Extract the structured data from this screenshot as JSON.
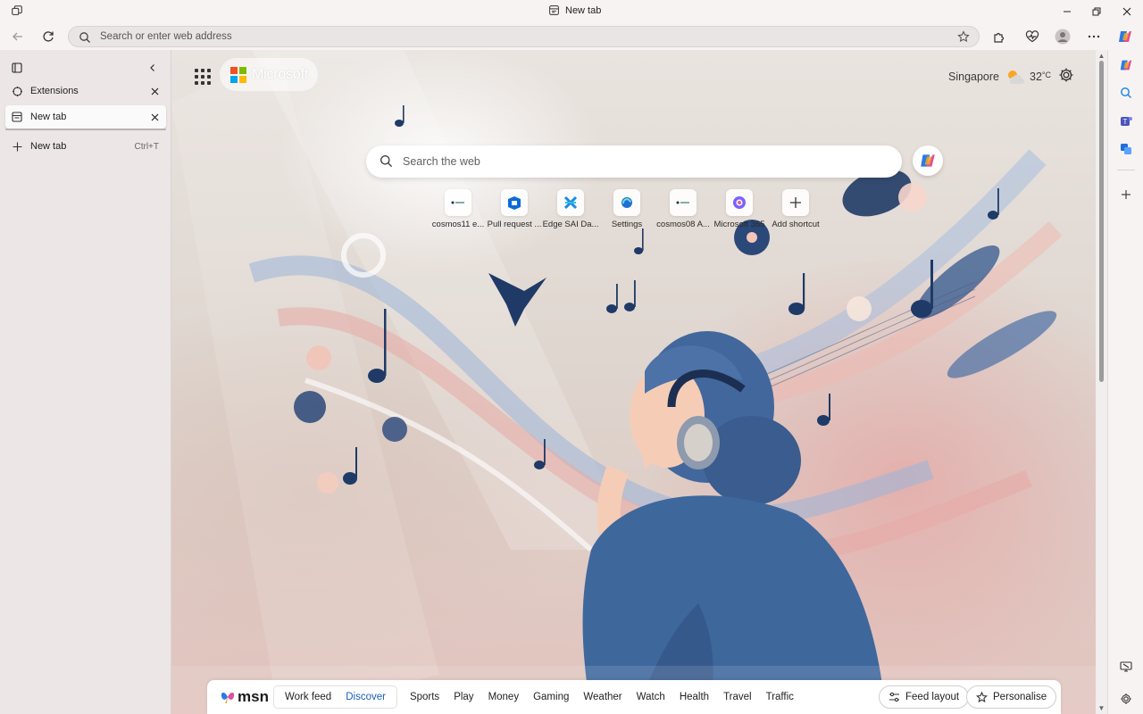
{
  "window": {
    "title": "New tab"
  },
  "addressbar": {
    "placeholder": "Search or enter web address"
  },
  "vertical_tabs": {
    "items": [
      {
        "label": "Extensions"
      },
      {
        "label": "New tab"
      }
    ],
    "new_tab_label": "New tab",
    "new_tab_shortcut": "Ctrl+T"
  },
  "newtab": {
    "brand": "Microsoft",
    "weather": {
      "location": "Singapore",
      "temperature": "32",
      "unit": "°C"
    },
    "search_placeholder": "Search the web",
    "shortcuts": [
      {
        "label": "cosmos11 e...",
        "icon": "cosmos-icon"
      },
      {
        "label": "Pull request ...",
        "icon": "azure-devops-icon"
      },
      {
        "label": "Edge SAI Da...",
        "icon": "edge-sai-icon"
      },
      {
        "label": "Settings",
        "icon": "edge-settings-icon"
      },
      {
        "label": "cosmos08 A...",
        "icon": "cosmos-icon"
      },
      {
        "label": "Microsoft 365",
        "icon": "m365-icon"
      },
      {
        "label": "Add shortcut",
        "icon": "plus-icon"
      }
    ]
  },
  "feed": {
    "brand": "msn",
    "tabs_grouped": [
      "Work feed",
      "Discover"
    ],
    "selected_tab": "Discover",
    "tabs": [
      "Sports",
      "Play",
      "Money",
      "Gaming",
      "Weather",
      "Watch",
      "Health",
      "Travel",
      "Traffic"
    ],
    "feed_layout_label": "Feed layout",
    "personalise_label": "Personalise"
  },
  "colors": {
    "accent": "#1a5fb4",
    "ms_red": "#f25022",
    "ms_green": "#7fba00",
    "ms_blue": "#00a4ef",
    "ms_yellow": "#ffb900",
    "art_navy": "#1f3a66",
    "art_blue": "#4a6fa5"
  }
}
